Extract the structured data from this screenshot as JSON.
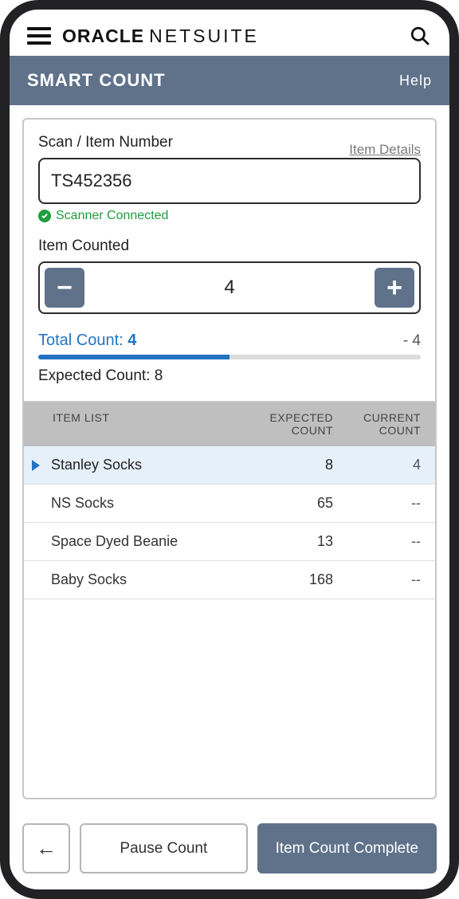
{
  "appbar": {
    "brand_oracle": "ORACLE",
    "brand_netsuite": "NETSUITE"
  },
  "titlebar": {
    "title": "SMART COUNT",
    "help_label": "Help"
  },
  "scan": {
    "label": "Scan / Item Number",
    "item_details_label": "Item Details",
    "value": "TS452356",
    "scanner_status": "Scanner Connected"
  },
  "counted": {
    "label": "Item Counted",
    "value": "4",
    "minus": "−",
    "plus": "+"
  },
  "totals": {
    "total_label": "Total Count:",
    "total_value": "4",
    "delta": "- 4",
    "expected_label": "Expected Count:",
    "expected_value": "8",
    "progress_pct": 50
  },
  "table": {
    "header": {
      "name": "ITEM LIST",
      "expected": "EXPECTED COUNT",
      "current": "CURRENT COUNT"
    },
    "rows": [
      {
        "name": "Stanley Socks",
        "expected": "8",
        "current": "4",
        "active": true
      },
      {
        "name": "NS Socks",
        "expected": "65",
        "current": "--",
        "active": false
      },
      {
        "name": "Space Dyed Beanie",
        "expected": "13",
        "current": "--",
        "active": false
      },
      {
        "name": "Baby Socks",
        "expected": "168",
        "current": "--",
        "active": false
      }
    ]
  },
  "footer": {
    "back": "←",
    "pause": "Pause Count",
    "complete": "Item Count Complete"
  }
}
